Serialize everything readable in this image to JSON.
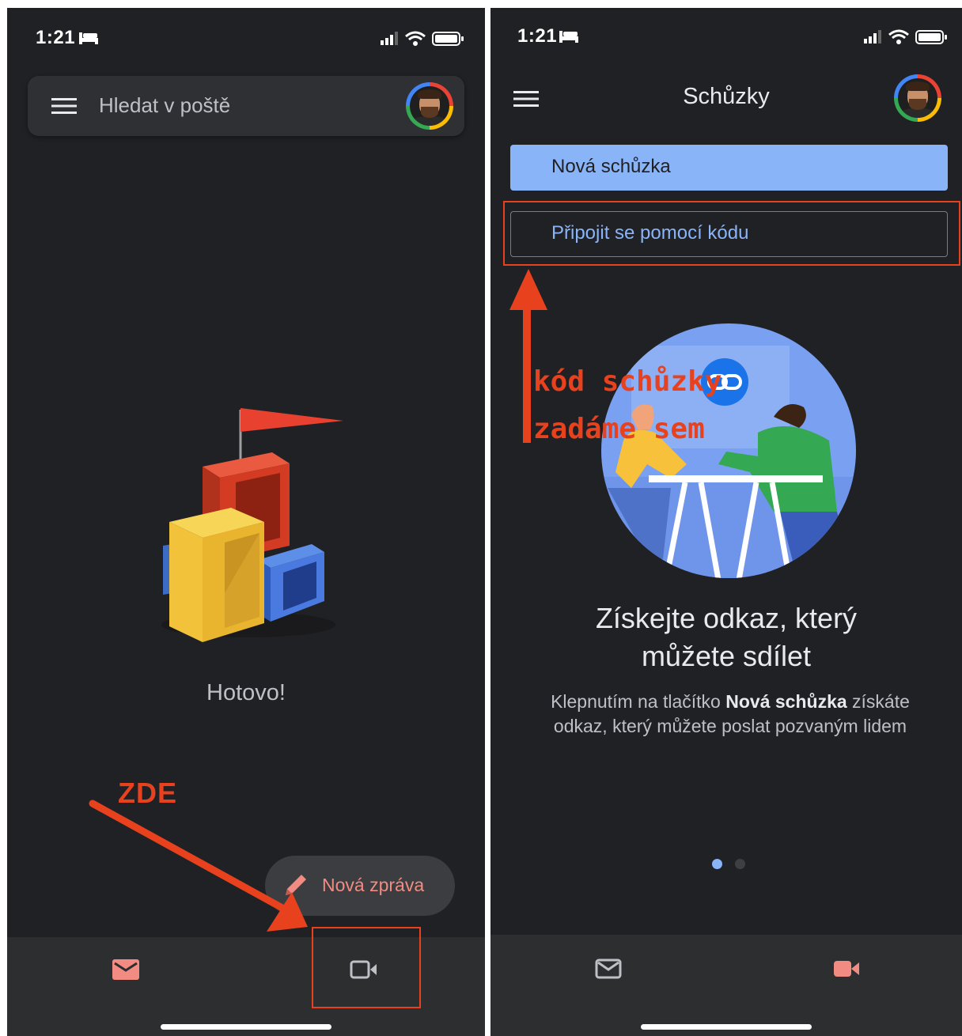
{
  "left_screen": {
    "status": {
      "time": "1:21"
    },
    "search": {
      "placeholder": "Hledat v poště"
    },
    "empty_state": {
      "text": "Hotovo!"
    },
    "fab": {
      "label": "Nová zpráva"
    },
    "annotation": {
      "label": "ZDE"
    }
  },
  "right_screen": {
    "status": {
      "time": "1:21"
    },
    "header": {
      "title": "Schůzky"
    },
    "buttons": {
      "new_meeting": "Nová schůzka",
      "join_code": "Připojit se pomocí kódu"
    },
    "annotation": {
      "line1": "kód schůzky",
      "line2": "zadáme sem"
    },
    "onboarding": {
      "headline_line1": "Získejte odkaz, který",
      "headline_line2": "můžete sdílet",
      "desc_before": "Klepnutím na tlačítko ",
      "desc_bold": "Nová schůzka",
      "desc_after": " získáte odkaz, který můžete poslat pozvaným lidem",
      "page_indicator": {
        "current": 1,
        "total": 2
      }
    }
  },
  "colors": {
    "background": "#202124",
    "accent_blue": "#8ab4f8",
    "accent_red": "#f28b82",
    "annotation_red": "#e8411e"
  },
  "icons": [
    "menu-icon",
    "mail-icon",
    "video-icon",
    "pencil-icon",
    "bed-icon",
    "signal-icon",
    "wifi-icon",
    "battery-icon",
    "link-icon"
  ]
}
